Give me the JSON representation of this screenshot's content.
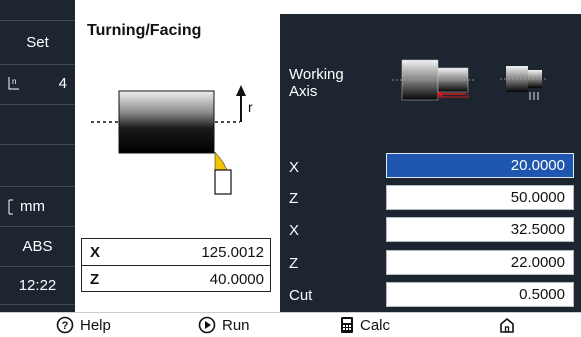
{
  "sidebar": {
    "set_label": "Set",
    "tool_number": "4",
    "unit": "mm",
    "mode": "ABS",
    "time": "12:22"
  },
  "center": {
    "title": "Turning/Facing",
    "diagram_label": "r",
    "position": {
      "x_axis": "X",
      "x_value": "125.0012",
      "z_axis": "Z",
      "z_value": "40.0000"
    }
  },
  "right": {
    "working_axis_line1": "Working",
    "working_axis_line2": "Axis",
    "params": [
      {
        "label": "X",
        "value": "20.0000",
        "active": true
      },
      {
        "label": "Z",
        "value": "50.0000",
        "active": false
      },
      {
        "label": "X",
        "value": "32.5000",
        "active": false
      },
      {
        "label": "Z",
        "value": "22.0000",
        "active": false
      },
      {
        "label": "Cut",
        "value": "0.5000",
        "active": false
      }
    ]
  },
  "bottom": {
    "help_label": "Help",
    "run_label": "Run",
    "calc_label": "Calc"
  },
  "colors": {
    "panel_dark": "#1c2530",
    "active_field": "#1e56b0",
    "tool_tip": "#f2c200",
    "feed_arrow": "#d11a1a"
  }
}
